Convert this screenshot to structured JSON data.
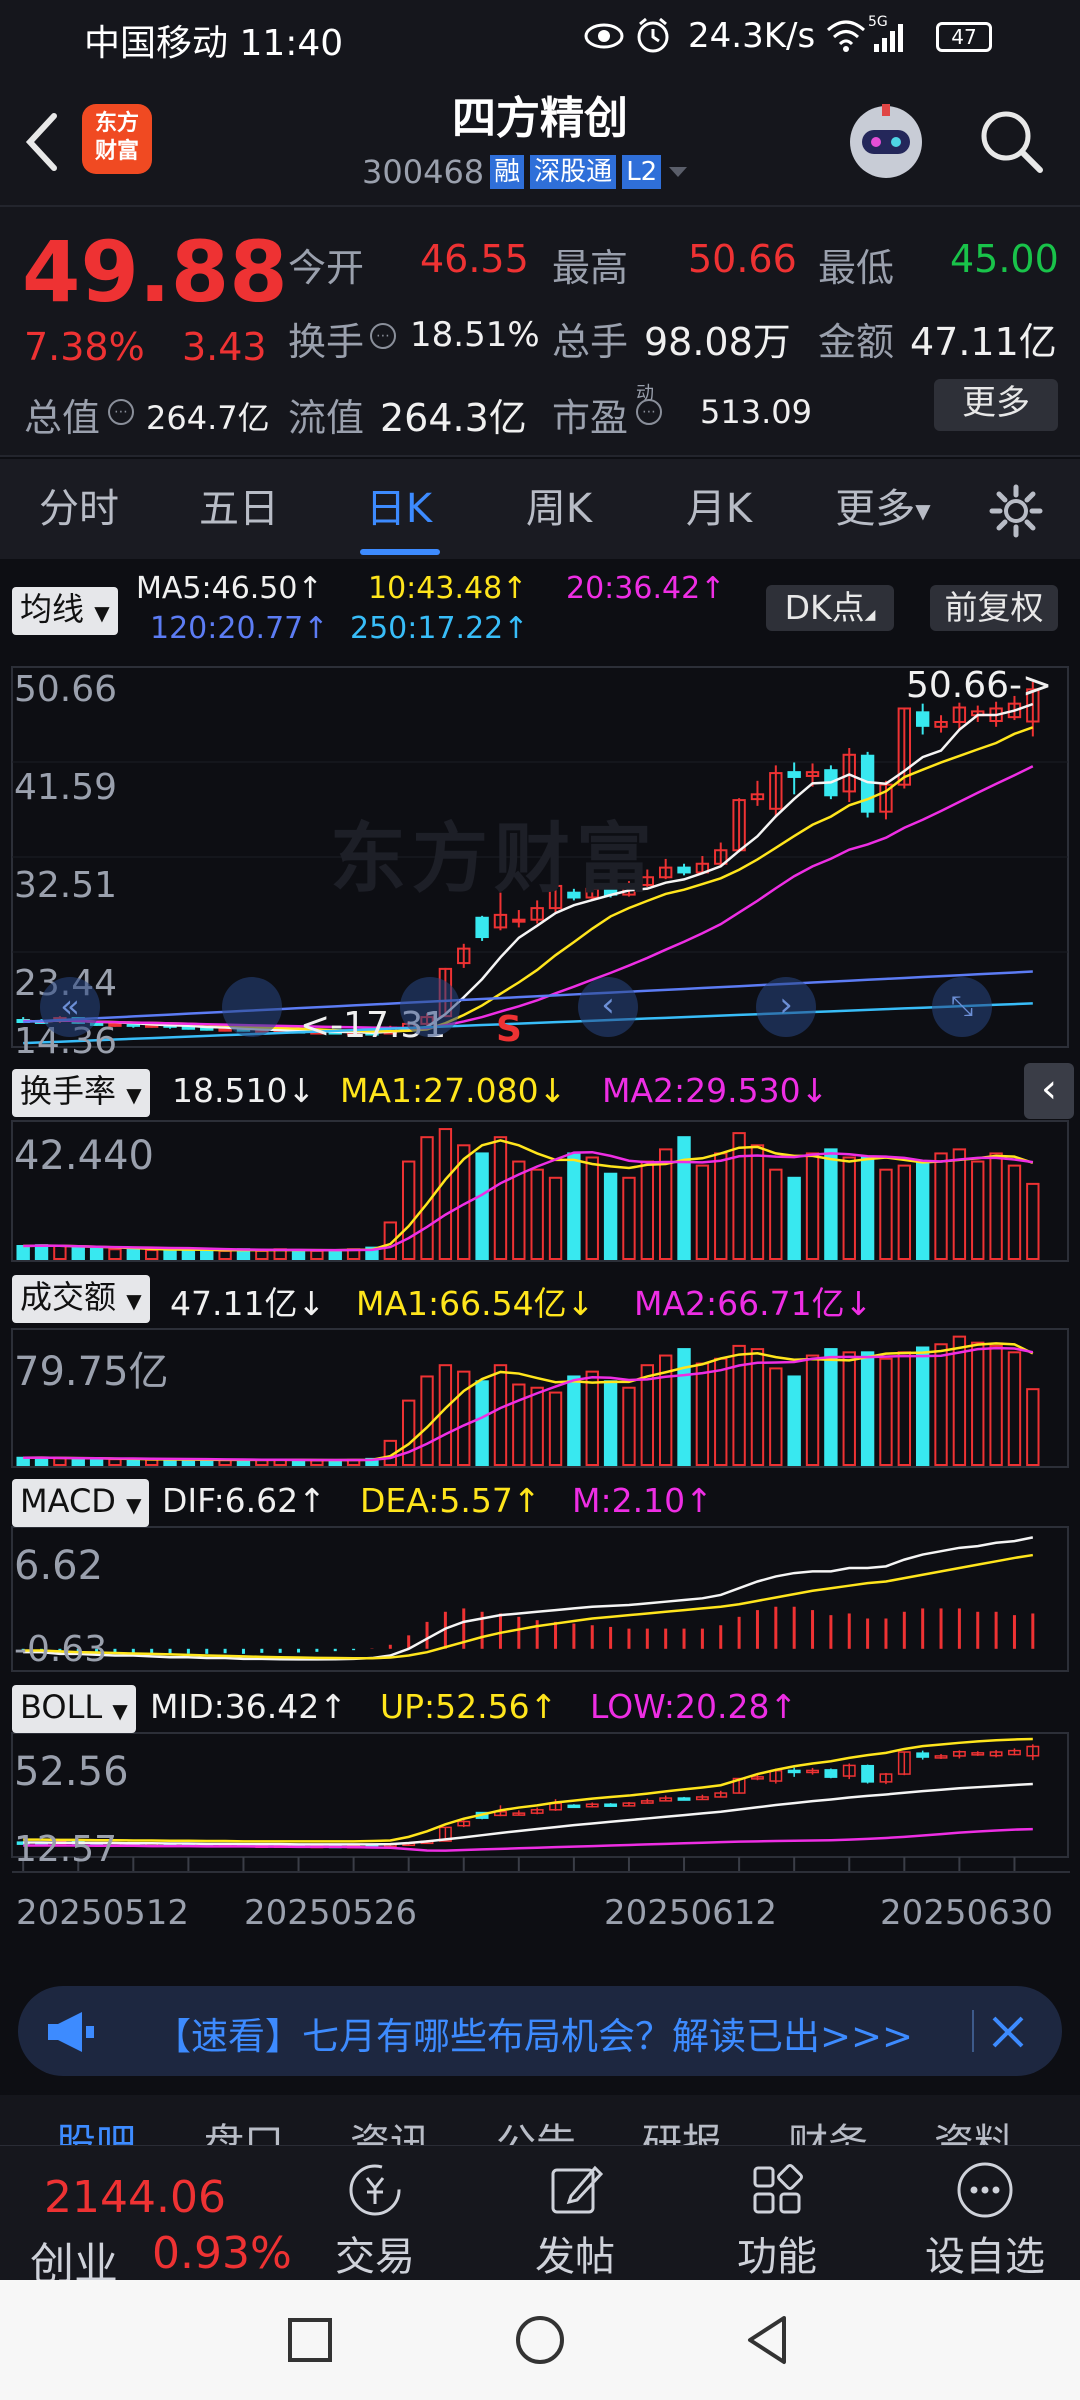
{
  "status_bar": {
    "carrier_time": "中国移动 11:40",
    "net_speed": "24.3K/s",
    "battery": "47",
    "net_gen": "5G"
  },
  "header": {
    "back": "‹",
    "logo_line1": "东方",
    "logo_line2": "财富",
    "stock_name": "四方精创",
    "stock_code": "300468",
    "tags": [
      "融",
      "深股通",
      "L2"
    ]
  },
  "quote": {
    "price": "49.88",
    "change_pct": "7.38%",
    "change_amt": "3.43",
    "open_label": "今开",
    "open_value": "46.55",
    "high_label": "最高",
    "high_value": "50.66",
    "low_label": "最低",
    "low_value": "45.00",
    "turnover_label": "换手",
    "turnover_value": "18.51%",
    "volume_label": "总手",
    "volume_value": "98.08万",
    "amount_label": "金额",
    "amount_value": "47.11亿",
    "total_cap_label": "总值",
    "total_cap_value": "264.7亿",
    "float_cap_label": "流值",
    "float_cap_value": "264.3亿",
    "pe_label": "市盈",
    "pe_sup": "动",
    "pe_value": "513.09",
    "more_button": "更多"
  },
  "tabs": [
    "分时",
    "五日",
    "日K",
    "周K",
    "月K",
    "更多"
  ],
  "active_tab": "日K",
  "kline": {
    "indicator": "均线",
    "ma5": "MA5:46.50↑",
    "ma10": "10:43.48↑",
    "ma20": "20:36.42↑",
    "ma120": "120:20.77↑",
    "ma250": "250:17.22↑",
    "dk_button": "DK点",
    "fq_button": "前复权",
    "y_labels": [
      "50.66",
      "41.59",
      "32.51",
      "23.44",
      "14.36"
    ],
    "high_marker": "50.66->",
    "low_marker": "<-17.31",
    "signal": "S",
    "watermark": "东方财富"
  },
  "turnover_panel": {
    "label": "换手率",
    "value": "18.510↓",
    "ma1": "MA1:27.080↓",
    "ma2": "MA2:29.530↓",
    "y_label": "42.440"
  },
  "volume_panel": {
    "label": "成交额",
    "value": "47.11亿↓",
    "ma1": "MA1:66.54亿↓",
    "ma2": "MA2:66.71亿↓",
    "y_label": "79.75亿"
  },
  "macd_panel": {
    "label": "MACD",
    "dif": "DIF:6.62↑",
    "dea": "DEA:5.57↑",
    "m": "M:2.10↑",
    "y_top": "6.62",
    "y_bottom": "-0.63"
  },
  "boll_panel": {
    "label": "BOLL",
    "mid": "MID:36.42↑",
    "up": "UP:52.56↑",
    "low": "LOW:20.28↑",
    "y_top": "52.56",
    "y_bottom": "12.57"
  },
  "dates": [
    "20250512",
    "20250526",
    "20250612",
    "20250630"
  ],
  "banner": {
    "text": "【速看】七月有哪些布局机会？解读已出>>>"
  },
  "sub_tabs": [
    "股吧",
    "盘口",
    "资讯",
    "公告",
    "研报",
    "财务",
    "资料"
  ],
  "bottom_bar": {
    "index_value": "2144.06",
    "index_name": "创业",
    "index_change": "0.93%",
    "items": [
      "交易",
      "发帖",
      "功能",
      "设自选"
    ]
  },
  "colors": {
    "up": "#ee3233",
    "down": "#38e8f0",
    "accent": "#3d8bff",
    "background": "#0d0e13"
  },
  "chart_data": {
    "type": "candlestick",
    "candles": [
      {
        "o": 15.6,
        "c": 15.5,
        "h": 15.9,
        "l": 15.3
      },
      {
        "o": 15.5,
        "c": 15.4,
        "h": 15.7,
        "l": 15.2
      },
      {
        "o": 15.5,
        "c": 15.8,
        "h": 16.0,
        "l": 15.3
      },
      {
        "o": 15.8,
        "c": 15.3,
        "h": 15.9,
        "l": 15.2
      },
      {
        "o": 15.3,
        "c": 15.1,
        "h": 15.5,
        "l": 15.0
      },
      {
        "o": 15.1,
        "c": 15.2,
        "h": 15.4,
        "l": 14.9
      },
      {
        "o": 15.2,
        "c": 15.0,
        "h": 15.3,
        "l": 14.8
      },
      {
        "o": 15.0,
        "c": 15.1,
        "h": 15.3,
        "l": 14.8
      },
      {
        "o": 15.1,
        "c": 14.9,
        "h": 15.2,
        "l": 14.7
      },
      {
        "o": 14.9,
        "c": 14.8,
        "h": 15.1,
        "l": 14.6
      },
      {
        "o": 14.8,
        "c": 14.6,
        "h": 14.9,
        "l": 14.5
      },
      {
        "o": 14.6,
        "c": 14.7,
        "h": 14.9,
        "l": 14.4
      },
      {
        "o": 14.7,
        "c": 14.5,
        "h": 14.8,
        "l": 14.4
      },
      {
        "o": 14.5,
        "c": 14.5,
        "h": 14.7,
        "l": 14.3
      },
      {
        "o": 14.5,
        "c": 14.5,
        "h": 14.7,
        "l": 14.3
      },
      {
        "o": 14.5,
        "c": 14.3,
        "h": 14.6,
        "l": 14.2
      },
      {
        "o": 14.3,
        "c": 14.4,
        "h": 14.5,
        "l": 14.2
      },
      {
        "o": 14.4,
        "c": 14.2,
        "h": 14.5,
        "l": 14.1
      },
      {
        "o": 14.2,
        "c": 14.3,
        "h": 14.4,
        "l": 14.1
      },
      {
        "o": 14.3,
        "c": 14.2,
        "h": 14.4,
        "l": 14.0
      },
      {
        "o": 14.2,
        "c": 14.8,
        "h": 15.0,
        "l": 14.1
      },
      {
        "o": 14.8,
        "c": 15.2,
        "h": 15.5,
        "l": 14.6
      },
      {
        "o": 15.2,
        "c": 15.9,
        "h": 16.3,
        "l": 15.0
      },
      {
        "o": 16.0,
        "c": 20.9,
        "h": 21.0,
        "l": 15.9
      },
      {
        "o": 21.5,
        "c": 23.0,
        "h": 23.5,
        "l": 21.0
      },
      {
        "o": 26.2,
        "c": 24.2,
        "h": 26.4,
        "l": 23.8
      },
      {
        "o": 25.2,
        "c": 26.5,
        "h": 28.8,
        "l": 24.9
      },
      {
        "o": 25.8,
        "c": 26.0,
        "h": 27.0,
        "l": 25.2
      },
      {
        "o": 26.0,
        "c": 27.2,
        "h": 28.0,
        "l": 25.6
      },
      {
        "o": 27.2,
        "c": 29.5,
        "h": 31.0,
        "l": 26.8
      },
      {
        "o": 28.8,
        "c": 28.3,
        "h": 29.2,
        "l": 28.0
      },
      {
        "o": 28.3,
        "c": 29.2,
        "h": 29.8,
        "l": 28.0
      },
      {
        "o": 29.2,
        "c": 28.6,
        "h": 29.6,
        "l": 28.3
      },
      {
        "o": 28.6,
        "c": 29.6,
        "h": 30.0,
        "l": 28.4
      },
      {
        "o": 29.6,
        "c": 30.4,
        "h": 31.2,
        "l": 29.4
      },
      {
        "o": 30.4,
        "c": 31.4,
        "h": 32.3,
        "l": 30.2
      },
      {
        "o": 31.4,
        "c": 30.9,
        "h": 31.8,
        "l": 30.6
      },
      {
        "o": 30.9,
        "c": 31.8,
        "h": 32.6,
        "l": 30.7
      },
      {
        "o": 31.8,
        "c": 33.2,
        "h": 34.0,
        "l": 31.6
      },
      {
        "o": 33.2,
        "c": 38.4,
        "h": 38.6,
        "l": 33.0
      },
      {
        "o": 38.5,
        "c": 39.0,
        "h": 40.4,
        "l": 37.8
      },
      {
        "o": 37.5,
        "c": 41.2,
        "h": 42.0,
        "l": 36.6
      },
      {
        "o": 41.3,
        "c": 40.8,
        "h": 42.3,
        "l": 39.0
      },
      {
        "o": 40.9,
        "c": 41.3,
        "h": 42.2,
        "l": 39.8
      },
      {
        "o": 41.5,
        "c": 38.9,
        "h": 42.0,
        "l": 38.5
      },
      {
        "o": 39.3,
        "c": 43.1,
        "h": 43.8,
        "l": 38.2
      },
      {
        "o": 43.0,
        "c": 37.2,
        "h": 43.4,
        "l": 36.6
      },
      {
        "o": 37.2,
        "c": 40.0,
        "h": 40.4,
        "l": 36.4
      },
      {
        "o": 40.0,
        "c": 47.9,
        "h": 48.0,
        "l": 39.6
      },
      {
        "o": 47.5,
        "c": 46.1,
        "h": 48.4,
        "l": 45.2
      },
      {
        "o": 46.0,
        "c": 46.5,
        "h": 47.2,
        "l": 45.4
      },
      {
        "o": 46.5,
        "c": 48.0,
        "h": 48.5,
        "l": 45.6
      },
      {
        "o": 47.2,
        "c": 47.6,
        "h": 48.2,
        "l": 46.5
      },
      {
        "o": 46.6,
        "c": 47.9,
        "h": 48.6,
        "l": 46.0
      },
      {
        "o": 47.0,
        "c": 48.4,
        "h": 49.2,
        "l": 46.7
      },
      {
        "o": 46.55,
        "c": 49.88,
        "h": 50.66,
        "l": 45.0
      }
    ],
    "price_axis": [
      14.36,
      50.66
    ],
    "turnover_pct": [
      3.2,
      3.4,
      3.2,
      2.8,
      2.5,
      2.4,
      2.6,
      2.2,
      2.0,
      2.4,
      2.2,
      2.0,
      2.4,
      2.0,
      2.4,
      2.2,
      2.0,
      2.2,
      2.4,
      2.8,
      9.0,
      24.0,
      30.0,
      32.0,
      28.0,
      26.0,
      30.0,
      24.0,
      22.0,
      20.0,
      26.0,
      25.0,
      21.0,
      20.0,
      24.0,
      27.0,
      30.0,
      23.0,
      26.0,
      31.0,
      28.0,
      22.0,
      20.0,
      26.0,
      27.0,
      25.0,
      25.0,
      22.0,
      23.0,
      24.0,
      26.0,
      27.0,
      24.0,
      26.0,
      23.0,
      18.5
    ],
    "amount_yi": [
      4.5,
      4.6,
      4.2,
      3.9,
      3.6,
      3.6,
      3.6,
      3.2,
      3.0,
      3.4,
      3.2,
      3.0,
      3.4,
      3.0,
      3.3,
      3.1,
      2.8,
      3.0,
      3.2,
      3.8,
      15.0,
      40.0,
      55.0,
      62.0,
      58.0,
      52.0,
      62.0,
      50.0,
      48.0,
      45.0,
      55.0,
      58.0,
      52.0,
      48.0,
      62.0,
      68.0,
      72.0,
      63.0,
      66.0,
      74.0,
      72.0,
      60.0,
      55.0,
      68.0,
      72.0,
      70.0,
      70.0,
      66.0,
      70.0,
      73.0,
      75.0,
      79.75,
      76.0,
      74.0,
      70.0,
      47.11
    ],
    "macd_dif": [
      -0.2,
      -0.2,
      -0.3,
      -0.3,
      -0.35,
      -0.4,
      -0.4,
      -0.45,
      -0.5,
      -0.5,
      -0.55,
      -0.55,
      -0.6,
      -0.6,
      -0.62,
      -0.63,
      -0.63,
      -0.62,
      -0.6,
      -0.55,
      -0.4,
      0.0,
      0.6,
      1.2,
      1.6,
      1.8,
      2.0,
      2.1,
      2.2,
      2.3,
      2.4,
      2.5,
      2.55,
      2.6,
      2.7,
      2.8,
      2.9,
      3.0,
      3.2,
      3.6,
      4.0,
      4.3,
      4.5,
      4.6,
      4.6,
      4.8,
      4.8,
      4.9,
      5.3,
      5.6,
      5.8,
      6.0,
      6.1,
      6.3,
      6.4,
      6.62
    ],
    "macd_dea": [
      -0.1,
      -0.1,
      -0.15,
      -0.2,
      -0.22,
      -0.25,
      -0.28,
      -0.3,
      -0.33,
      -0.36,
      -0.4,
      -0.42,
      -0.45,
      -0.48,
      -0.5,
      -0.52,
      -0.54,
      -0.55,
      -0.56,
      -0.56,
      -0.52,
      -0.4,
      -0.2,
      0.1,
      0.4,
      0.7,
      0.95,
      1.15,
      1.35,
      1.5,
      1.65,
      1.8,
      1.9,
      2.0,
      2.1,
      2.2,
      2.3,
      2.4,
      2.5,
      2.65,
      2.85,
      3.05,
      3.25,
      3.45,
      3.6,
      3.75,
      3.9,
      4.0,
      4.2,
      4.4,
      4.6,
      4.8,
      5.0,
      5.2,
      5.4,
      5.57
    ],
    "boll_up": [
      16.5,
      16.5,
      16.4,
      16.4,
      16.3,
      16.3,
      16.2,
      16.2,
      16.1,
      16.1,
      16.0,
      16.0,
      15.9,
      15.9,
      15.9,
      15.9,
      15.9,
      15.9,
      15.9,
      16.0,
      16.2,
      17.5,
      19.5,
      22.0,
      24.0,
      25.5,
      27.0,
      28.0,
      28.8,
      29.8,
      30.5,
      31.2,
      31.8,
      32.3,
      33.0,
      33.8,
      34.5,
      35.2,
      36.0,
      38.0,
      40.0,
      41.5,
      42.8,
      43.8,
      44.6,
      45.8,
      46.8,
      47.6,
      49.0,
      50.0,
      50.6,
      51.2,
      51.7,
      52.1,
      52.4,
      52.56
    ],
    "boll_mid": [
      15.5,
      15.5,
      15.4,
      15.4,
      15.3,
      15.3,
      15.2,
      15.2,
      15.1,
      15.1,
      15.0,
      15.0,
      14.9,
      14.9,
      14.9,
      14.8,
      14.8,
      14.8,
      14.8,
      14.8,
      14.9,
      15.3,
      15.9,
      16.6,
      17.3,
      18.1,
      18.9,
      19.6,
      20.3,
      21.0,
      21.7,
      22.3,
      22.9,
      23.5,
      24.1,
      24.7,
      25.3,
      25.9,
      26.5,
      27.3,
      28.1,
      28.9,
      29.6,
      30.3,
      30.9,
      31.6,
      32.2,
      32.7,
      33.3,
      33.9,
      34.4,
      34.9,
      35.3,
      35.7,
      36.1,
      36.42
    ],
    "boll_low": [
      14.4,
      14.4,
      14.4,
      14.4,
      14.3,
      14.3,
      14.3,
      14.2,
      14.2,
      14.2,
      14.1,
      14.1,
      14.1,
      14.0,
      14.0,
      13.9,
      13.9,
      13.9,
      13.8,
      13.7,
      13.6,
      13.1,
      12.6,
      12.57,
      12.8,
      13.0,
      13.2,
      13.4,
      13.6,
      13.8,
      14.0,
      14.2,
      14.4,
      14.6,
      14.8,
      15.0,
      15.2,
      15.4,
      15.6,
      15.8,
      15.9,
      16.0,
      16.1,
      16.2,
      16.3,
      16.5,
      16.8,
      17.1,
      17.5,
      18.0,
      18.5,
      19.0,
      19.4,
      19.8,
      20.1,
      20.28
    ]
  }
}
